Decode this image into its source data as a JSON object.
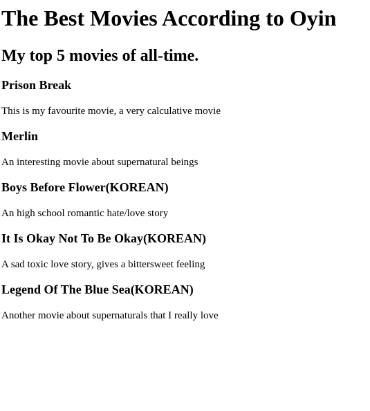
{
  "page": {
    "title": "The Best Movies According to Oyin",
    "subtitle": "My top 5 movies of all-time."
  },
  "movies": [
    {
      "title": "Prison Break",
      "description": "This is my favourite movie, a very calculative movie"
    },
    {
      "title": "Merlin",
      "description": "An interesting movie about supernatural beings"
    },
    {
      "title": "Boys Before Flower(KOREAN)",
      "description": "An high school romantic hate/love story"
    },
    {
      "title": "It Is Okay Not To Be Okay(KOREAN)",
      "description": "A sad toxic love story, gives a bittersweet feeling"
    },
    {
      "title": "Legend Of The Blue Sea(KOREAN)",
      "description": "Another movie about supernaturals that I really love"
    }
  ]
}
